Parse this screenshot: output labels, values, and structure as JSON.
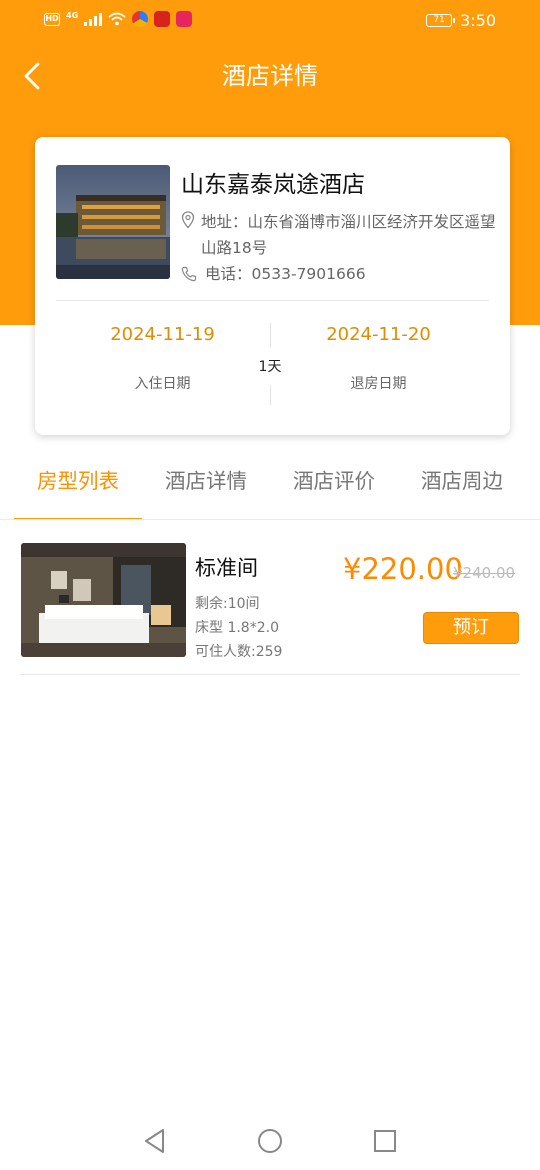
{
  "status_bar": {
    "time": "3:50",
    "battery": "71",
    "hd_badge": "HD",
    "network": "4G"
  },
  "header": {
    "title": "酒店详情"
  },
  "hotel": {
    "name": "山东嘉泰岚途酒店",
    "address_label": "地址：",
    "address": "山东省淄博市淄川区经济开发区遥望山路18号",
    "phone_label": "电话：",
    "phone": "0533-7901666",
    "checkin_date": "2024-11-19",
    "checkin_label": "入住日期",
    "checkout_date": "2024-11-20",
    "checkout_label": "退房日期",
    "nights": "1天"
  },
  "tabs": [
    {
      "label": "房型列表",
      "active": true
    },
    {
      "label": "酒店详情",
      "active": false
    },
    {
      "label": "酒店评价",
      "active": false
    },
    {
      "label": "酒店周边",
      "active": false
    }
  ],
  "rooms": [
    {
      "name": "标准间",
      "remaining": "剩余:10间",
      "bed": "床型 1.8*2.0",
      "capacity": "可住人数:259",
      "price": "¥220.00",
      "original_price": "¥240.00",
      "book_label": "预订"
    }
  ],
  "colors": {
    "accent": "#ff9c0c",
    "price": "#ff8a00",
    "date": "#e38b00"
  }
}
